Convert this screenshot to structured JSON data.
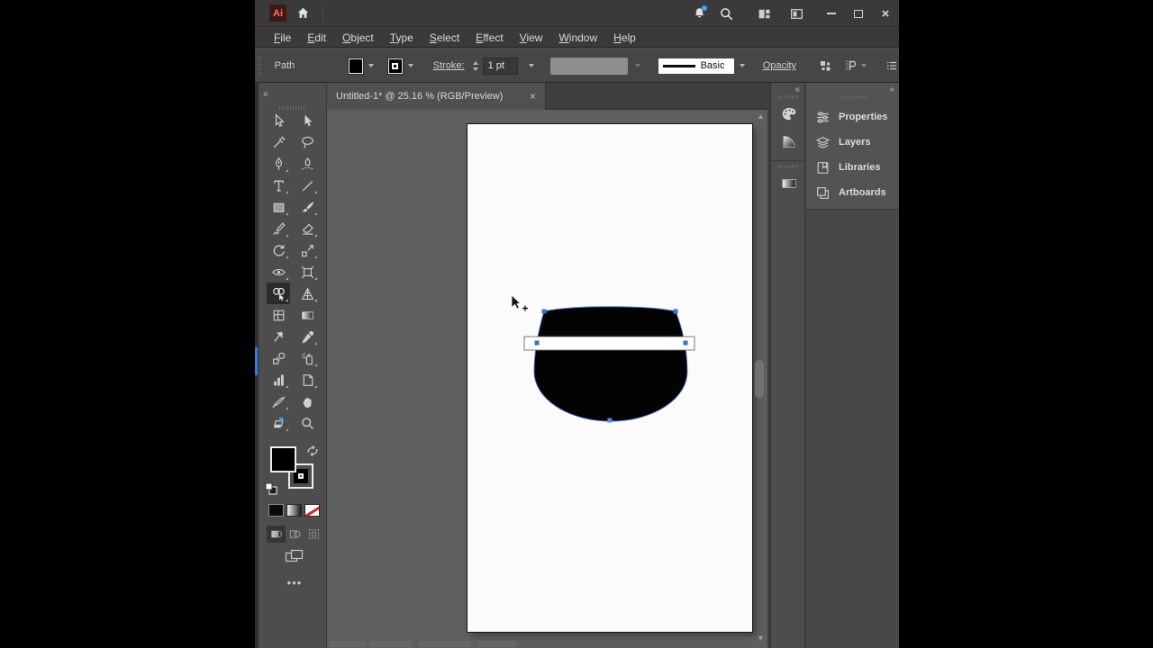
{
  "titlebar": {
    "app_badge": "Ai",
    "close_glyph": "×"
  },
  "menu_items": [
    "File",
    "Edit",
    "Object",
    "Type",
    "Select",
    "Effect",
    "View",
    "Window",
    "Help"
  ],
  "control_bar": {
    "selection_type": "Path",
    "stroke_label": "Stroke:",
    "stroke_weight": "1 pt",
    "brush_definition": "Basic",
    "opacity_label": "Opacity"
  },
  "document_tab": {
    "title": "Untitled-1* @ 25.16 % (RGB/Preview)",
    "close_glyph": "×"
  },
  "toolbar": {
    "selected_tool": "shape-builder-tool",
    "tools": [
      "selection",
      "direct-selection",
      "magic-wand",
      "lasso",
      "pen",
      "curvature",
      "type",
      "line-segment",
      "rectangle",
      "paintbrush",
      "shaper",
      "eraser",
      "rotate",
      "scale",
      "width",
      "free-transform",
      "shape-builder",
      "perspective-grid",
      "mesh",
      "gradient",
      "puppet-warp",
      "eyedropper",
      "blend",
      "symbol-sprayer",
      "column-graph",
      "artboard",
      "slice",
      "hand",
      "print-tiling",
      "zoom"
    ],
    "fill_color": "#000000",
    "stroke_color": "#ffffff",
    "more_glyph": "•••"
  },
  "right_dock": {
    "panel_tabs": [
      {
        "label": "Properties"
      },
      {
        "label": "Layers"
      },
      {
        "label": "Libraries"
      },
      {
        "label": "Artboards"
      }
    ],
    "strip_icons": [
      "color-panel",
      "color-guide-panel",
      "gradient-panel"
    ]
  },
  "canvas": {
    "artboard_fill": "#fbfbfb",
    "shape_fill": "#000000",
    "band_fill": "#ffffff",
    "selection_color": "#3a6fd0"
  },
  "colors": {
    "notification_dot": "#31a8ff",
    "selection_blue": "#3a6fd0",
    "ai_badge_bg": "#401815",
    "ai_badge_text": "#ff6b5e"
  }
}
